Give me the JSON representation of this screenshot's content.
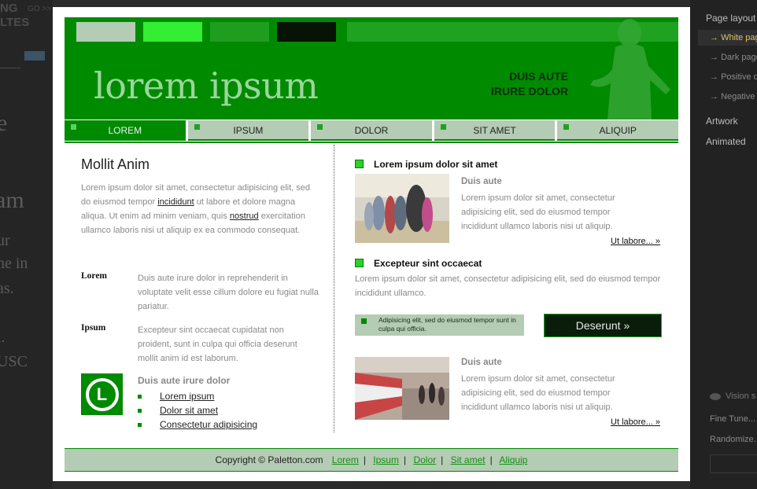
{
  "background_left": {
    "top_text": "NG LTES",
    "top_small": "GO >>",
    "serif_lines": [
      "e",
      "am",
      "ur",
      "ne in",
      "as.",
      "l.",
      "USC"
    ]
  },
  "panel": {
    "title": "Page layout",
    "items": [
      {
        "label": "White page",
        "active": true
      },
      {
        "label": "Dark page",
        "active": false
      },
      {
        "label": "Positive de",
        "active": false
      },
      {
        "label": "Negative c",
        "active": false
      }
    ],
    "artwork": "Artwork",
    "animated": "Animated",
    "vision": "Vision s",
    "fine_tune": "Fine Tune...",
    "randomize": "Randomize..."
  },
  "colors": {
    "primary": "#008a00",
    "light": "#b3ccb3",
    "bright": "#2ad02a",
    "dark": "#0a1d0a",
    "swatches": [
      "#b3ccb3",
      "#33ee33",
      "#1f9d1f",
      "#061306",
      "#1fa21f"
    ]
  },
  "header": {
    "logo": "lorem ipsum",
    "tagline_1": "DUIS AUTE",
    "tagline_2": "IRURE DOLOR"
  },
  "nav": [
    "LOREM",
    "IPSUM",
    "DOLOR",
    "SIT AMET",
    "ALIQUIP"
  ],
  "left": {
    "title": "Mollit Anim",
    "p1_a": "Lorem ipsum dolor sit amet, consectetur adipisicing elit, sed do eiusmod tempor",
    "p1_link1": "incididunt",
    "p1_b": "ut labore et dolore magna aliqua. Ut enim ad minim veniam, quis",
    "p1_link2": "nostrud",
    "p1_c": "exercitation ullamco laboris nisi ut aliquip ex ea commodo consequat.",
    "def1_term": "Lorem",
    "def1_desc": "Duis aute irure dolor in reprehenderit in voluptate velit esse cillum dolore eu fugiat nulla pariatur.",
    "def2_term": "Ipsum",
    "def2_desc": "Excepteur sint occaecat cupidatat non proident, sunt in culpa qui officia deserunt mollit anim id est laborum.",
    "badge_letter": "L",
    "list_title": "Duis aute irure dolor",
    "list": [
      "Lorem ipsum",
      "Dolor sit amet",
      "Consectetur adipisicing"
    ]
  },
  "right": {
    "h1": "Lorem ipsum dolor sit amet",
    "item1_title": "Duis aute",
    "item1_text": "Lorem ipsum dolor sit amet, consectetur adipisicing elit, sed do eiusmod tempor incididunt ullamco laboris nisi ut aliquip.",
    "more": "Ut labore... »",
    "h2": "Excepteur sint occaecat",
    "p2": "Lorem ipsum dolor sit amet, consectetur adipisicing elit, sed do eiusmod tempor incididunt ullamco.",
    "callout": "Adipisicing elit, sed do eiusmod tempor sunt in culpa qui officia.",
    "button": "Deserunt »",
    "item2_title": "Duis aute",
    "item2_text": "Lorem ipsum dolor sit amet, consectetur adipisicing elit, sed do eiusmod tempor incididunt ullamco laboris nisi ut aliquip."
  },
  "footer": {
    "copyright": "Copyright © Paletton.com",
    "links": [
      "Lorem",
      "Ipsum",
      "Dolor",
      "Sit amet",
      "Aliquip"
    ]
  }
}
